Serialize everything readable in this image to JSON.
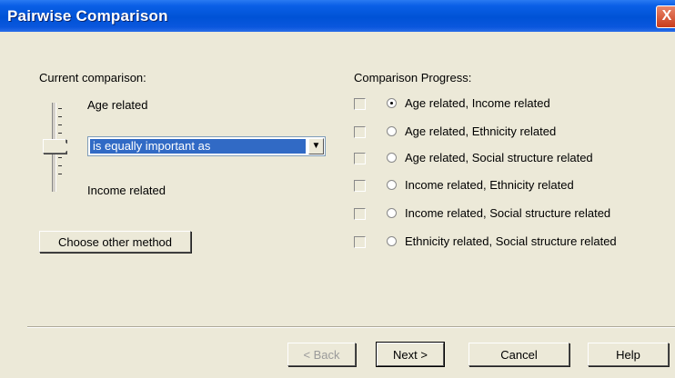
{
  "window": {
    "title": "Pairwise Comparison",
    "close_glyph": "X"
  },
  "current": {
    "heading": "Current comparison:",
    "top_label": "Age related",
    "bottom_label": "Income related",
    "dropdown_value": "is equally important as",
    "slider_level": 0.5
  },
  "choose_button": "Choose other method",
  "progress": {
    "heading": "Comparison Progress:",
    "items": [
      {
        "label": "Age related, Income related",
        "checked": false,
        "selected": true
      },
      {
        "label": "Age related, Ethnicity related",
        "checked": false,
        "selected": false
      },
      {
        "label": "Age related, Social structure related",
        "checked": false,
        "selected": false
      },
      {
        "label": "Income related, Ethnicity related",
        "checked": false,
        "selected": false
      },
      {
        "label": "Income related, Social structure related",
        "checked": false,
        "selected": false
      },
      {
        "label": "Ethnicity related, Social structure related",
        "checked": false,
        "selected": false
      }
    ]
  },
  "buttons": {
    "back": "< Back",
    "next": "Next >",
    "cancel": "Cancel",
    "help": "Help"
  }
}
